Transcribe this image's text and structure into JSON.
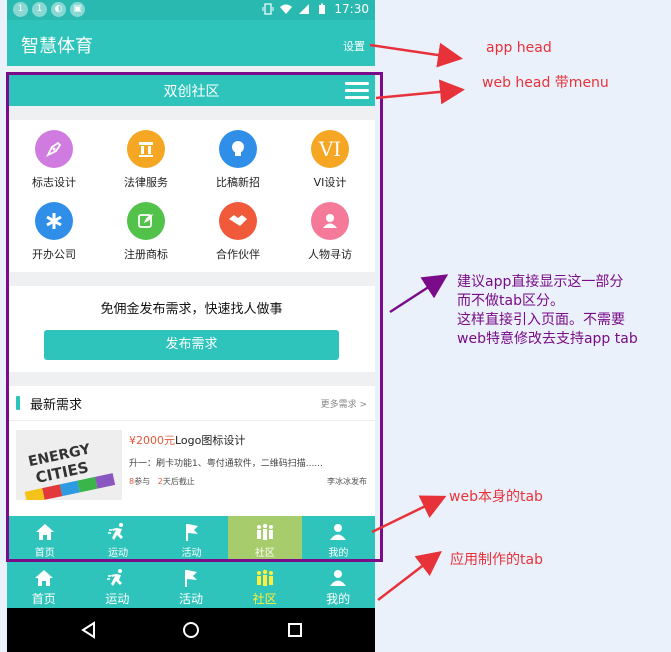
{
  "status_bar": {
    "time": "17:30",
    "dots": [
      "1",
      "1"
    ]
  },
  "app_head": {
    "title": "智慧体育",
    "settings_label": "设置"
  },
  "web_head": {
    "title": "双创社区"
  },
  "services": [
    {
      "label": "标志设计",
      "color": "#d07be0",
      "icon": "pen-icon"
    },
    {
      "label": "法律服务",
      "color": "#f5a623",
      "icon": "pillar-icon"
    },
    {
      "label": "比稿新招",
      "color": "#2f8fe8",
      "icon": "bulb-icon"
    },
    {
      "label": "VI设计",
      "color": "#f5a623",
      "icon": "vi-icon",
      "glyph": "VI"
    },
    {
      "label": "开办公司",
      "color": "#2f8fe8",
      "icon": "asterisk-icon"
    },
    {
      "label": "注册商标",
      "color": "#52c24a",
      "icon": "leaf-icon"
    },
    {
      "label": "合作伙伴",
      "color": "#f05a3a",
      "icon": "handshake-icon"
    },
    {
      "label": "人物寻访",
      "color": "#f57a9a",
      "icon": "person-icon"
    }
  ],
  "publish": {
    "text": "免佣金发布需求，快速找人做事",
    "button_label": "发布需求"
  },
  "needs": {
    "title": "最新需求",
    "more": "更多需求 >",
    "item": {
      "price": "¥2000元",
      "name": "Logo图标设计",
      "desc": "升一：刷卡功能1、粤付通软件，二维码扫描......",
      "participants": "8",
      "participants_label": "参与",
      "days": "2",
      "days_label": "天后截止",
      "author": "李冰冰发布",
      "image_text": [
        "ENERGY",
        "CITIES"
      ]
    }
  },
  "web_tabs": [
    {
      "label": "首页",
      "icon": "home-icon"
    },
    {
      "label": "运动",
      "icon": "run-icon"
    },
    {
      "label": "活动",
      "icon": "flag-icon"
    },
    {
      "label": "社区",
      "icon": "people-icon",
      "active": true
    },
    {
      "label": "我的",
      "icon": "user-icon"
    }
  ],
  "app_tabs": [
    {
      "label": "首页",
      "icon": "home-icon"
    },
    {
      "label": "运动",
      "icon": "run-icon"
    },
    {
      "label": "活动",
      "icon": "flag-icon"
    },
    {
      "label": "社区",
      "icon": "people-icon",
      "active": true
    },
    {
      "label": "我的",
      "icon": "user-icon"
    }
  ],
  "annotations": {
    "app_head": "app head",
    "web_head": "web head 带menu",
    "suggestion": [
      "建议app直接显示这一部分",
      "而不做tab区分。",
      "这样直接引入页面。不需要",
      "web特意修改去支持app tab"
    ],
    "web_tab": "web本身的tab",
    "app_tab": "应用制作的tab"
  },
  "colors": {
    "accent": "#2ec4bb",
    "annotation_red": "#e8323a",
    "annotation_purple": "#7a0c8a",
    "active_tab": "#a6cc6b"
  }
}
